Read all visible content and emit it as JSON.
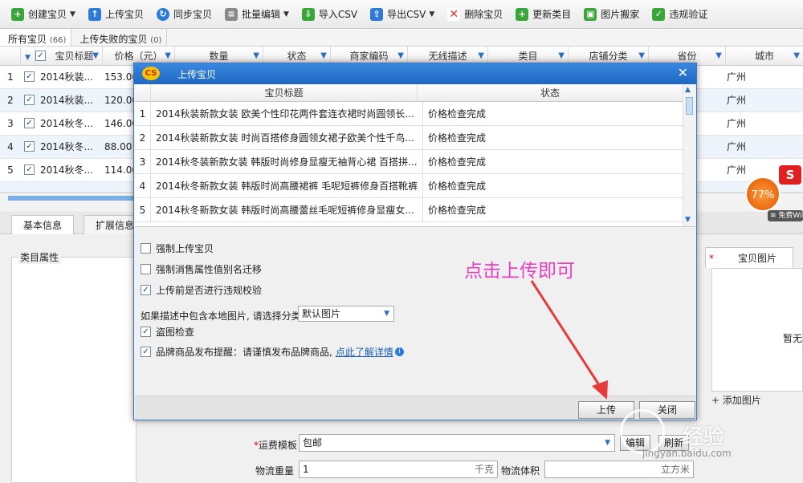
{
  "toolbar": {
    "items": [
      {
        "label": "创建宝贝",
        "icon": "plus-icon",
        "color": "#3aa63a"
      },
      {
        "label": "上传宝贝",
        "icon": "upload-icon",
        "color": "#2e7ad8"
      },
      {
        "label": "同步宝贝",
        "icon": "sync-icon",
        "color": "#2e7ad8"
      },
      {
        "label": "批量编辑",
        "icon": "batch-edit-icon",
        "color": "#6b6b6b"
      },
      {
        "label": "导入CSV",
        "icon": "import-csv-icon",
        "color": "#3aa63a"
      },
      {
        "label": "导出CSV",
        "icon": "export-csv-icon",
        "color": "#2e7ad8"
      },
      {
        "label": "删除宝贝",
        "icon": "delete-icon",
        "color": "#d83a2e"
      },
      {
        "label": "更新类目",
        "icon": "update-category-icon",
        "color": "#3aa63a"
      },
      {
        "label": "图片搬家",
        "icon": "image-move-icon",
        "color": "#3aa63a"
      },
      {
        "label": "违规验证",
        "icon": "verify-icon",
        "color": "#3aa63a"
      }
    ]
  },
  "tabs": [
    {
      "label": "所有宝贝",
      "count": "(66)"
    },
    {
      "label": "上传失败的宝贝",
      "count": "(0)"
    }
  ],
  "grid": {
    "headers": [
      "宝贝标题",
      "价格（元）",
      "数量",
      "状态",
      "商家编码",
      "无线描述",
      "类目",
      "店铺分类",
      "省份",
      "城市"
    ],
    "rows": [
      {
        "num": "1",
        "title": "2014秋装...",
        "price": "153.00",
        "city": "广州"
      },
      {
        "num": "2",
        "title": "2014秋装...",
        "price": "120.00",
        "city": "广州"
      },
      {
        "num": "3",
        "title": "2014秋冬...",
        "price": "146.00",
        "city": "广州"
      },
      {
        "num": "4",
        "title": "2014秋冬...",
        "price": "88.00",
        "city": "广州"
      },
      {
        "num": "5",
        "title": "2014秋冬...",
        "price": "114.00",
        "city": "广州"
      }
    ]
  },
  "lower": {
    "tabs": [
      "基本信息",
      "扩展信息"
    ],
    "category_label": "类目属性",
    "image_tab": "宝贝图片",
    "image_star": "*",
    "no_image": "暂无图",
    "add_image": "+ 添加图片",
    "shipping_label": "运费模板",
    "shipping_required": "*",
    "shipping_value": "包邮",
    "edit_btn": "编辑",
    "refresh_btn": "刷新",
    "weight_label": "物流重量",
    "weight_value": "1",
    "weight_unit": "千克",
    "volume_label": "物流体积",
    "volume_unit": "立方米"
  },
  "modal": {
    "title": "上传宝贝",
    "logo": "CS",
    "col_title": "宝贝标题",
    "col_status": "状态",
    "rows": [
      {
        "num": "1",
        "title": "2014秋装新款女装 欧美个性印花两件套连衣裙时尚圆领长...",
        "status": "价格检查完成"
      },
      {
        "num": "2",
        "title": "2014秋装新款女装 时尚百搭修身圆领女裙子欧美个性千鸟...",
        "status": "价格检查完成"
      },
      {
        "num": "3",
        "title": "2014秋冬装新款女装 韩版时尚修身显瘦无袖背心裙 百搭拼...",
        "status": "价格检查完成"
      },
      {
        "num": "4",
        "title": "2014秋冬新款女装 韩版时尚高腰裙裤 毛呢短裤修身百搭靴裤",
        "status": "价格检查完成"
      },
      {
        "num": "5",
        "title": "2014秋冬新款女装 韩版时尚高腰蕾丝毛呢短裤修身显瘦女...",
        "status": "价格检查完成"
      }
    ],
    "options": [
      {
        "label": "强制上传宝贝",
        "checked": false
      },
      {
        "label": "强制消售属性值别名迁移",
        "checked": false
      },
      {
        "label": "上传前是否进行违规校验",
        "checked": true
      }
    ],
    "select_label": "如果描述中包含本地图片, 请选择分类",
    "select_value": "默认图片",
    "theft_check": "盗图检查",
    "brand_reminder": "品牌商品发布提醒：请谨慎发布品牌商品,",
    "brand_link": "点此了解详情",
    "upload_btn": "上传",
    "close_btn": "关闭"
  },
  "annotation": "点击上传即可",
  "widget": {
    "percent": "77%",
    "logo": "S",
    "bar": "免费WiFi"
  },
  "watermark": {
    "text": "经验",
    "url": "jingyan.baidu.com"
  },
  "colors": {
    "accent": "#2e6fc2",
    "annotation": "#e83fbf",
    "arrow": "#e83a3a"
  }
}
